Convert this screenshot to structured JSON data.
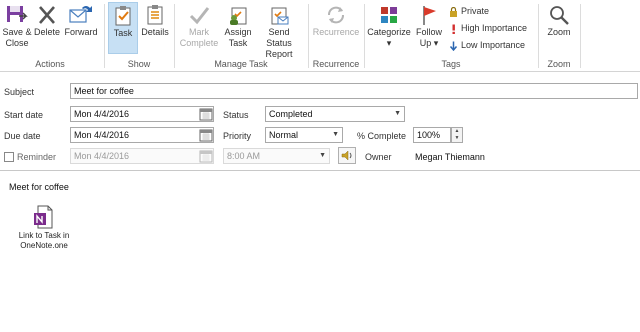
{
  "ribbon": {
    "save_close_line1": "Save &",
    "save_close_line2": "Close",
    "delete": "Delete",
    "forward": "Forward",
    "task": "Task",
    "details": "Details",
    "mark_complete_line1": "Mark",
    "mark_complete_line2": "Complete",
    "assign_task_line1": "Assign",
    "assign_task_line2": "Task",
    "send_status_line1": "Send Status",
    "send_status_line2": "Report",
    "recurrence": "Recurrence",
    "categorize": "Categorize",
    "follow_up_line1": "Follow",
    "follow_up_line2": "Up",
    "private": "Private",
    "high_importance": "High Importance",
    "low_importance": "Low Importance",
    "zoom": "Zoom",
    "groups": {
      "actions": "Actions",
      "show": "Show",
      "manage_task": "Manage Task",
      "recurrence": "Recurrence",
      "tags": "Tags",
      "zoom": "Zoom"
    }
  },
  "form": {
    "subject_label": "Subject",
    "subject_value": "Meet for coffee",
    "start_label": "Start date",
    "start_value": "Mon 4/4/2016",
    "due_label": "Due date",
    "due_value": "Mon 4/4/2016",
    "reminder_label": "Reminder",
    "reminder_date": "Mon 4/4/2016",
    "reminder_time": "8:00 AM",
    "status_label": "Status",
    "status_value": "Completed",
    "priority_label": "Priority",
    "priority_value": "Normal",
    "pct_label": "% Complete",
    "pct_value": "100%",
    "owner_label": "Owner",
    "owner_value": "Megan Thiemann"
  },
  "body": {
    "text": "Meet for coffee",
    "attachment_line1": "Link to Task in",
    "attachment_line2": "OneNote.one"
  }
}
